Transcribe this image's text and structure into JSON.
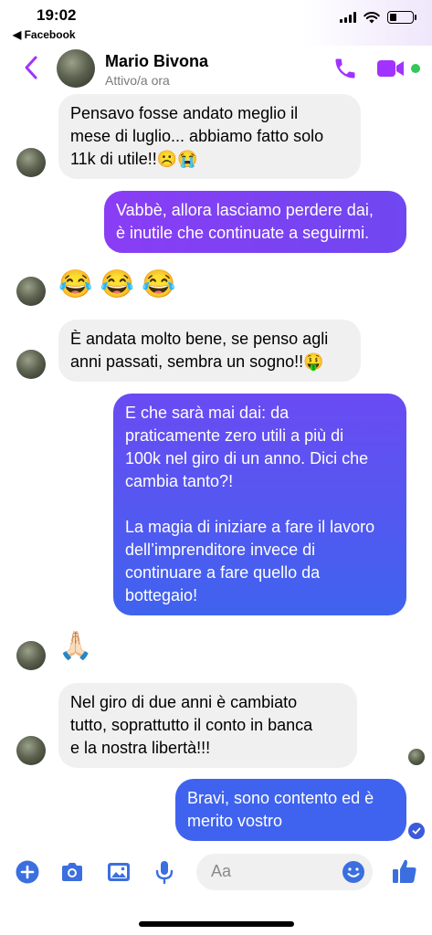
{
  "status_bar": {
    "time": "19:02",
    "back_app": "◀ Facebook",
    "battery_level": 0.3
  },
  "header": {
    "contact_name": "Mario Bivona",
    "contact_status": "Attivo/a ora",
    "accent_color": "#a033ff",
    "online_color": "#34c759"
  },
  "messages": [
    {
      "from": "contact",
      "text": "Pensavo fosse andato meglio il\nmese di luglio... abbiamo fatto solo\n11k di utile!!☹️😭"
    },
    {
      "from": "me",
      "text": "Vabbè, allora lasciamo perdere dai,\nè inutile che continuate a seguirmi."
    },
    {
      "from": "contact",
      "text": "😂 😂 😂"
    },
    {
      "from": "contact",
      "text": "È andata molto bene, se penso agli\nanni passati, sembra un sogno!!🤑"
    },
    {
      "from": "me",
      "text": "E che sarà mai dai: da\npraticamente zero utili a più di\n100k nel giro di un anno. Dici che\ncambia tanto?!\n\nLa magia di iniziare a fare il lavoro\ndell’imprenditore invece di\ncontinuare a fare quello da\nbottegaio!"
    },
    {
      "from": "contact",
      "text": "🙏🏻"
    },
    {
      "from": "contact",
      "text": "Nel giro di due anni è cambiato\ntutto, soprattutto il conto in banca\ne la nostra libertà!!!"
    },
    {
      "from": "me",
      "text": "Bravi, sono contento ed è\nmerito vostro"
    }
  ],
  "composer": {
    "placeholder": "Aa"
  },
  "colors": {
    "bubble_gradient_top": "#8b3df2",
    "bubble_gradient_bottom": "#3f63ee",
    "icon_blue": "#3b6fe0"
  }
}
